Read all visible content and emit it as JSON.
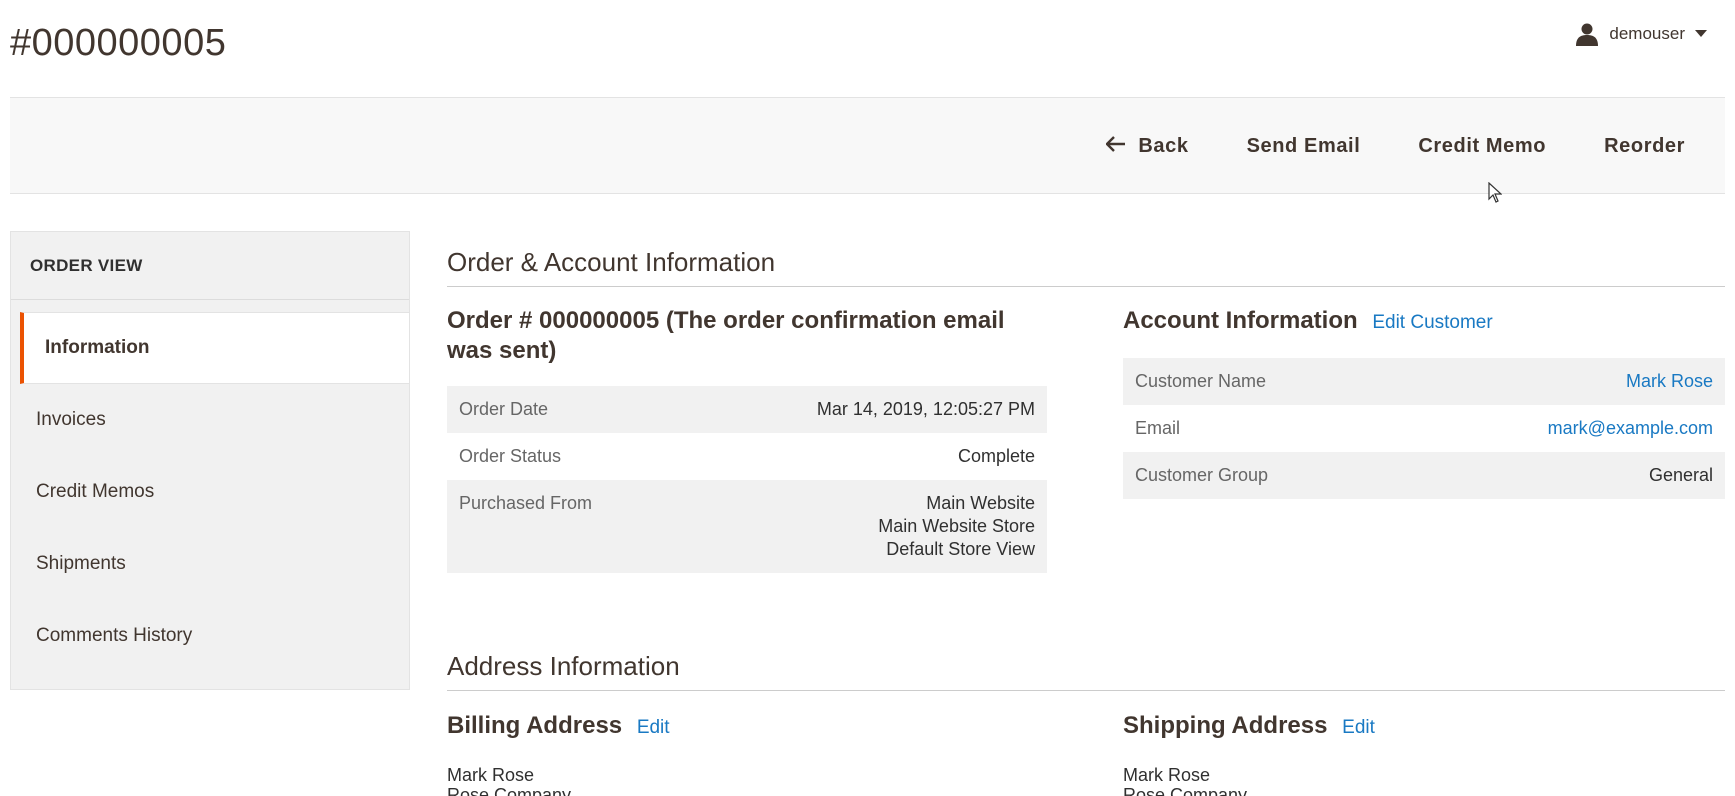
{
  "header": {
    "page_title": "#000000005",
    "username": "demouser"
  },
  "actions": {
    "back": "Back",
    "send_email": "Send Email",
    "credit_memo": "Credit Memo",
    "reorder": "Reorder"
  },
  "sidebar": {
    "title": "ORDER VIEW",
    "items": [
      {
        "label": "Information"
      },
      {
        "label": "Invoices"
      },
      {
        "label": "Credit Memos"
      },
      {
        "label": "Shipments"
      },
      {
        "label": "Comments History"
      }
    ]
  },
  "order_account": {
    "section_title": "Order & Account Information",
    "order_title": "Order # 000000005 (The order confirmation email was sent)",
    "order_rows": [
      {
        "label": "Order Date",
        "value": "Mar 14, 2019, 12:05:27 PM"
      },
      {
        "label": "Order Status",
        "value": "Complete"
      },
      {
        "label": "Purchased From",
        "value_lines": [
          "Main Website",
          "Main Website Store",
          "Default Store View"
        ]
      }
    ],
    "account_title": "Account Information",
    "edit_customer": "Edit Customer",
    "account_rows": [
      {
        "label": "Customer Name",
        "value": "Mark Rose"
      },
      {
        "label": "Email",
        "value": "mark@example.com"
      },
      {
        "label": "Customer Group",
        "value": "General"
      }
    ]
  },
  "address": {
    "section_title": "Address Information",
    "billing_title": "Billing Address",
    "shipping_title": "Shipping Address",
    "edit_label": "Edit",
    "billing_lines": [
      "Mark Rose",
      "Rose Company"
    ],
    "shipping_lines": [
      "Mark Rose",
      "Rose Company"
    ]
  },
  "colors": {
    "accent": "#eb5202",
    "link": "#1979c3"
  }
}
